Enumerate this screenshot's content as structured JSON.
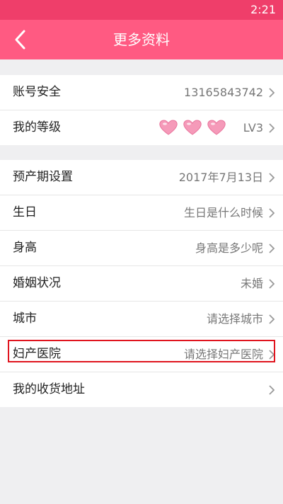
{
  "status_bar": {
    "time": "2:21"
  },
  "header": {
    "title": "更多资料"
  },
  "group1": {
    "account": {
      "label": "账号安全",
      "value": "13165843742"
    },
    "level": {
      "label": "我的等级",
      "value": "LV3",
      "hearts": 3
    }
  },
  "group2": {
    "due_date": {
      "label": "预产期设置",
      "value": "2017年7月13日"
    },
    "birthday": {
      "label": "生日",
      "value": "生日是什么时候"
    },
    "height": {
      "label": "身高",
      "value": "身高是多少呢"
    },
    "marital": {
      "label": "婚姻状况",
      "value": "未婚"
    },
    "city": {
      "label": "城市",
      "value": "请选择城市"
    },
    "hospital": {
      "label": "妇产医院",
      "value": "请选择妇产医院"
    },
    "address": {
      "label": "我的收货地址",
      "value": ""
    }
  },
  "colors": {
    "header": "#ff5a82",
    "status_bar": "#ef3e6a",
    "heart": "#f59ab9",
    "highlight": "#e0141e"
  },
  "icons": [
    "back-arrow-icon",
    "chevron-right-icon",
    "heart-icon"
  ]
}
